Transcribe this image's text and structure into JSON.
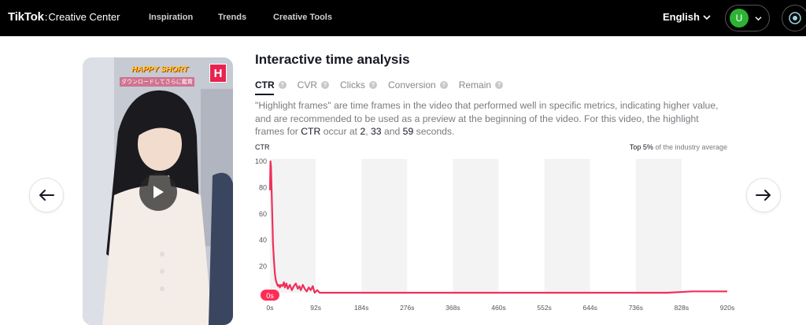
{
  "header": {
    "logo_main": "TikTok",
    "logo_sep": ":",
    "logo_sub": "Creative Center",
    "nav": [
      "Inspiration",
      "Trends",
      "Creative Tools"
    ],
    "language": "English",
    "user_initial": "U"
  },
  "video": {
    "banner_title": "HAPPY SHORT",
    "banner_sub": "ダウンロードしてさらに鑑賞",
    "badge": "H"
  },
  "analysis": {
    "title": "Interactive time analysis",
    "tabs": [
      "CTR",
      "CVR",
      "Clicks",
      "Conversion",
      "Remain"
    ],
    "active_tab": "CTR",
    "desc_part1": "\"Highlight frames\" are time frames in the video that performed well in specific metrics, indicating higher value, and are recommended to be used as a preview at the beginning of the video. For this video, the highlight frames for ",
    "desc_metric": "CTR",
    "desc_part2": " occur at ",
    "desc_s1": "2",
    "desc_comma": ", ",
    "desc_s2": "33",
    "desc_and": " and ",
    "desc_s3": "59",
    "desc_part3": " seconds.",
    "top_note_bold": "Top 5%",
    "top_note_rest": " of the industry average"
  },
  "colors": {
    "accent": "#fe2c55",
    "line": "#f0305a",
    "band": "#f3f3f4"
  },
  "chart_data": {
    "type": "line",
    "ylabel": "CTR",
    "ylim": [
      0,
      100
    ],
    "yticks": [
      "100",
      "80",
      "60",
      "40",
      "20",
      "0"
    ],
    "xticks": [
      "0s",
      "92s",
      "184s",
      "276s",
      "368s",
      "460s",
      "552s",
      "644s",
      "736s",
      "828s",
      "920s"
    ],
    "xlim": [
      0,
      920
    ],
    "marker_label": "0s",
    "series": [
      {
        "x": [
          0,
          1,
          2,
          3,
          4,
          5,
          6,
          8,
          10,
          12,
          14,
          16,
          18,
          20,
          22,
          25,
          28,
          30,
          33,
          36,
          40,
          44,
          48,
          52,
          56,
          59,
          62,
          66,
          70,
          74,
          78,
          82,
          86,
          90,
          95,
          100,
          120,
          150,
          200,
          300,
          400,
          500,
          600,
          700,
          800,
          850,
          900,
          920
        ],
        "y": [
          78,
          100,
          96,
          82,
          68,
          52,
          38,
          24,
          14,
          9,
          7,
          5,
          6,
          4,
          6,
          5,
          8,
          4,
          7,
          3,
          6,
          2,
          5,
          7,
          3,
          5,
          2,
          6,
          3,
          1,
          4,
          2,
          5,
          0,
          2,
          0,
          0,
          0,
          0,
          0,
          0,
          0,
          0,
          0,
          0,
          1,
          1,
          1
        ]
      }
    ]
  }
}
